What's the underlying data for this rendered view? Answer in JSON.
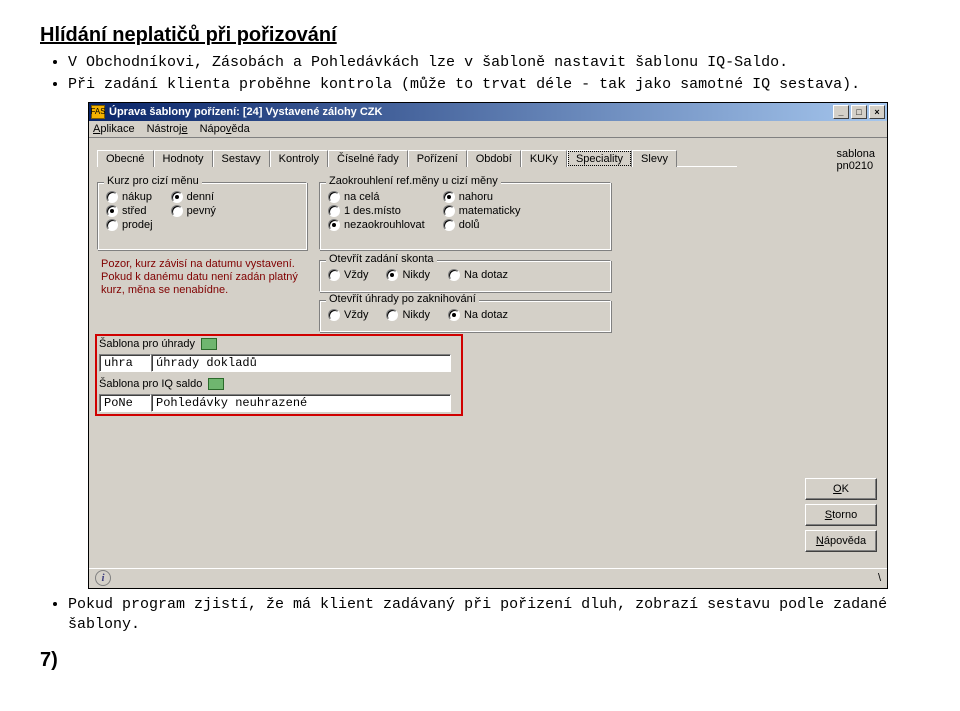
{
  "doc": {
    "title": "Hlídání neplatičů při pořizování",
    "bullet1": "V Obchodníkovi, Zásobách a Pohledávkách lze v šabloně nastavit šablonu IQ-Saldo.",
    "bullet2": "Při zadání klienta proběhne kontrola (může to trvat déle - tak jako samotné IQ sestava).",
    "bullet3": "Pokud program zjistí, že má klient zadávaný při pořizení dluh, zobrazí sestavu podle zadané šablony.",
    "section7": "7)"
  },
  "window": {
    "title": "Úprava šablony pořízení: [24] Vystavené zálohy CZK",
    "icon_text": "FAS",
    "menu": {
      "aplikace": "Aplikace",
      "nastroje": "Nástroje",
      "napoveda": "Nápověda"
    },
    "tabs": [
      "Obecné",
      "Hodnoty",
      "Sestavy",
      "Kontroly",
      "Číselné řady",
      "Pořízení",
      "Období",
      "KUKy",
      "Speciality",
      "Slevy"
    ],
    "active_tab_index": 8,
    "sablona": {
      "label": "sablona",
      "value": "pn0210"
    },
    "group_kurz": {
      "title": "Kurz pro cizí měnu",
      "col1": [
        {
          "label": "nákup",
          "selected": false
        },
        {
          "label": "střed",
          "selected": true
        },
        {
          "label": "prodej",
          "selected": false
        }
      ],
      "col2": [
        {
          "label": "denní",
          "selected": true
        },
        {
          "label": "pevný",
          "selected": false
        }
      ]
    },
    "group_zaokr": {
      "title": "Zaokrouhlení ref.měny u cizí měny",
      "col1": [
        {
          "label": "na celá",
          "selected": false
        },
        {
          "label": "1 des.místo",
          "selected": false
        },
        {
          "label": "nezaokrouhlovat",
          "selected": true
        }
      ],
      "col2": [
        {
          "label": "nahoru",
          "selected": true
        },
        {
          "label": "matematicky",
          "selected": false
        },
        {
          "label": "dolů",
          "selected": false
        }
      ]
    },
    "warning": "Pozor, kurz závisí na datumu vystavení. Pokud k danému datu není zadán platný kurz, měna se nenabídne.",
    "group_skonto": {
      "title": "Otevřít zadání skonta",
      "opts": [
        {
          "label": "Vždy",
          "selected": false
        },
        {
          "label": "Nikdy",
          "selected": true
        },
        {
          "label": "Na dotaz",
          "selected": false
        }
      ]
    },
    "group_uhrady": {
      "title": "Otevřít úhrady po zaknihování",
      "opts": [
        {
          "label": "Vždy",
          "selected": false
        },
        {
          "label": "Nikdy",
          "selected": false
        },
        {
          "label": "Na dotaz",
          "selected": true
        }
      ]
    },
    "sablona_uhrady": {
      "label": "Šablona pro úhrady",
      "code": "uhra",
      "desc": "úhrady dokladů"
    },
    "sablona_iq": {
      "label": "Šablona pro IQ saldo",
      "code": "PoNe",
      "desc": "Pohledávky neuhrazené"
    },
    "buttons": {
      "ok": "OK",
      "storno": "Storno",
      "napoveda": "Nápověda"
    },
    "status_slash": "\\"
  }
}
